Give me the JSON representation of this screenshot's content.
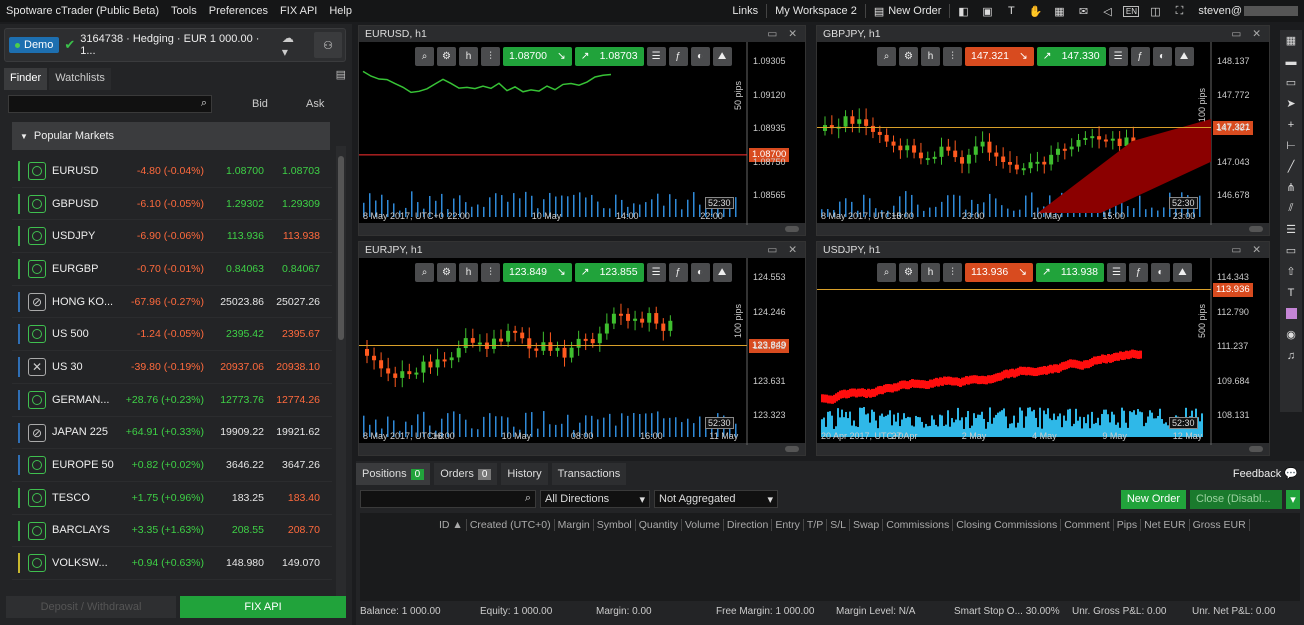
{
  "menubar": {
    "app_title": "Spotware cTrader (Public Beta)",
    "items": [
      "Tools",
      "Preferences",
      "FIX API",
      "Help"
    ],
    "links": "Links",
    "workspace": "My Workspace 2",
    "new_order": "New Order",
    "lang": "EN",
    "user": "steven@"
  },
  "account": {
    "mode": "Demo",
    "text": "3164738 · Hedging · EUR 1 000.00 · 1..."
  },
  "left_tabs": [
    "Finder",
    "Watchlists"
  ],
  "finder": {
    "bid_label": "Bid",
    "ask_label": "Ask"
  },
  "popular": "Popular Markets",
  "symbols": [
    {
      "name": "EURUSD",
      "chg": "-4.80 (-0.04%)",
      "bid": "1.08700",
      "ask": "1.08703",
      "dir": "down",
      "bcol": "grn",
      "acol": "grn",
      "bar": "grn",
      "icon": "o"
    },
    {
      "name": "GBPUSD",
      "chg": "-6.10 (-0.05%)",
      "bid": "1.29302",
      "ask": "1.29309",
      "dir": "down",
      "bcol": "grn",
      "acol": "grn",
      "bar": "grn",
      "icon": "o"
    },
    {
      "name": "USDJPY",
      "chg": "-6.90 (-0.06%)",
      "bid": "113.936",
      "ask": "113.938",
      "dir": "down",
      "bcol": "grn",
      "acol": "red",
      "bar": "grn",
      "icon": "o"
    },
    {
      "name": "EURGBP",
      "chg": "-0.70 (-0.01%)",
      "bid": "0.84063",
      "ask": "0.84067",
      "dir": "down",
      "bcol": "grn",
      "acol": "grn",
      "bar": "grn",
      "icon": "o"
    },
    {
      "name": "HONG KO...",
      "chg": "-67.96 (-0.27%)",
      "bid": "25023.86",
      "ask": "25027.26",
      "dir": "down",
      "bcol": "wht",
      "acol": "wht",
      "bar": "blue",
      "icon": "no"
    },
    {
      "name": "US 500",
      "chg": "-1.24 (-0.05%)",
      "bid": "2395.42",
      "ask": "2395.67",
      "dir": "down",
      "bcol": "grn",
      "acol": "red",
      "bar": "blue",
      "icon": "o"
    },
    {
      "name": "US 30",
      "chg": "-39.80 (-0.19%)",
      "bid": "20937.06",
      "ask": "20938.10",
      "dir": "down",
      "bcol": "red",
      "acol": "red",
      "bar": "blue",
      "icon": "x"
    },
    {
      "name": "GERMAN...",
      "chg": "+28.76 (+0.23%)",
      "bid": "12773.76",
      "ask": "12774.26",
      "dir": "up",
      "bcol": "grn",
      "acol": "red",
      "bar": "blue",
      "icon": "o"
    },
    {
      "name": "JAPAN 225",
      "chg": "+64.91 (+0.33%)",
      "bid": "19909.22",
      "ask": "19921.62",
      "dir": "up",
      "bcol": "wht",
      "acol": "wht",
      "bar": "blue",
      "icon": "no"
    },
    {
      "name": "EUROPE 50",
      "chg": "+0.82 (+0.02%)",
      "bid": "3646.22",
      "ask": "3647.26",
      "dir": "up",
      "bcol": "wht",
      "acol": "wht",
      "bar": "blue",
      "icon": "o"
    },
    {
      "name": "TESCO",
      "chg": "+1.75 (+0.96%)",
      "bid": "183.25",
      "ask": "183.40",
      "dir": "up",
      "bcol": "wht",
      "acol": "red",
      "bar": "grn",
      "icon": "o"
    },
    {
      "name": "BARCLAYS",
      "chg": "+3.35 (+1.63%)",
      "bid": "208.55",
      "ask": "208.70",
      "dir": "up",
      "bcol": "grn",
      "acol": "red",
      "bar": "grn",
      "icon": "o"
    },
    {
      "name": "VOLKSW...",
      "chg": "+0.94 (+0.63%)",
      "bid": "148.980",
      "ask": "149.070",
      "dir": "up",
      "bcol": "wht",
      "acol": "wht",
      "bar": "yel",
      "icon": "o"
    }
  ],
  "left_buttons": {
    "deposit": "Deposit / Withdrawal",
    "fix": "FIX API"
  },
  "charts": [
    {
      "title": "EURUSD, h1",
      "sell": "1.08700",
      "buy": "1.08703",
      "price_tag": "1.08700",
      "tag_color": "#d84b1f",
      "yticks": [
        "1.09305",
        "1.09120",
        "1.08935",
        "1.08750",
        "1.08565"
      ],
      "xticks": [
        "8 May 2017, UTC+0",
        "22:00",
        "10 May",
        "14:00",
        "22:00"
      ],
      "pips": "50 pips",
      "timer": "52:30"
    },
    {
      "title": "GBPJPY, h1",
      "sell": "147.321",
      "buy": "147.330",
      "price_tag": "147.321",
      "tag_color": "#d84b1f",
      "yticks": [
        "148.137",
        "147.772",
        "147.407",
        "147.043",
        "146.678"
      ],
      "xticks": [
        "8 May 2017, UTC+0",
        "15:00",
        "23:00",
        "10 May",
        "15:00",
        "23:00"
      ],
      "pips": "100 pips",
      "timer": "52:30"
    },
    {
      "title": "EURJPY, h1",
      "sell": "123.849",
      "buy": "123.855",
      "price_tag": "123.849",
      "tag_color": "#d84b1f",
      "yticks": [
        "124.553",
        "124.246",
        "123.938",
        "123.631",
        "123.323"
      ],
      "xticks": [
        "8 May 2017, UTC+0",
        "16:00",
        "10 May",
        "08:00",
        "16:00",
        "11 May"
      ],
      "pips": "100 pips",
      "timer": "52:30"
    },
    {
      "title": "USDJPY, h1",
      "sell": "113.936",
      "buy": "113.938",
      "price_tag": "113.936",
      "tag_color": "#d84b1f",
      "yticks": [
        "114.343",
        "112.790",
        "111.237",
        "109.684",
        "108.131"
      ],
      "xticks": [
        "20 Apr 2017, UTC+0",
        "27 Apr",
        "2 May",
        "4 May",
        "9 May",
        "12 May"
      ],
      "pips": "500 pips",
      "timer": "52:30"
    }
  ],
  "bottom": {
    "tabs": [
      {
        "label": "Positions",
        "count": "0"
      },
      {
        "label": "Orders",
        "count": "0"
      },
      {
        "label": "History"
      },
      {
        "label": "Transactions"
      }
    ],
    "feedback": "Feedback",
    "filter_dir": "All Directions",
    "filter_agg": "Not Aggregated",
    "new_order": "New Order",
    "close_all": "Close (Disabl...",
    "columns": [
      "ID ▲",
      "Created (UTC+0)",
      "Margin",
      "Symbol",
      "Quantity",
      "Volume",
      "Direction",
      "Entry",
      "T/P",
      "S/L",
      "Swap",
      "Commissions",
      "Closing Commissions",
      "Comment",
      "Pips",
      "Net EUR",
      "Gross EUR"
    ],
    "status": {
      "balance": "Balance: 1 000.00",
      "equity": "Equity: 1 000.00",
      "margin": "Margin: 0.00",
      "free_margin": "Free Margin: 1 000.00",
      "margin_level": "Margin Level: N/A",
      "smart_stop": "Smart Stop O... 30.00%",
      "unr_gross": "Unr. Gross P&L: 0.00",
      "unr_net": "Unr. Net P&L: 0.00"
    }
  }
}
